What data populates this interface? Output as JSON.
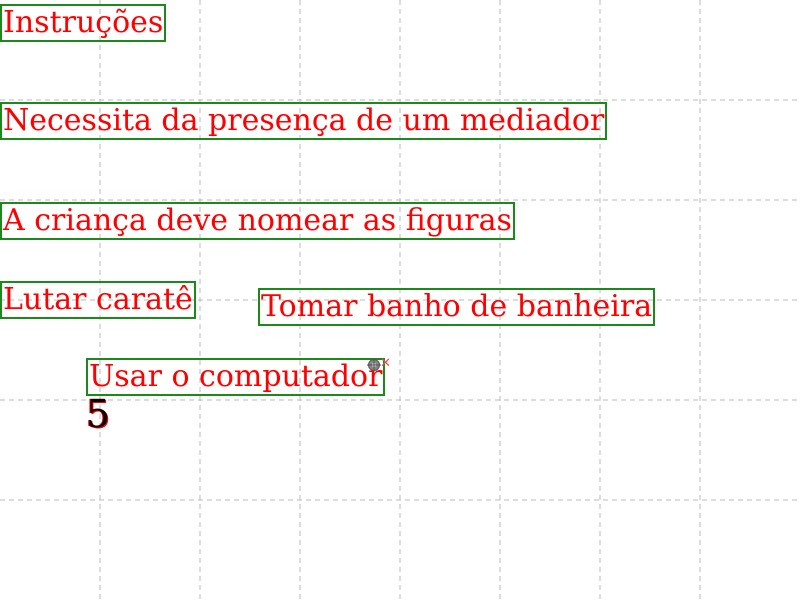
{
  "labels": {
    "instructions": "Instruções",
    "mediator": "Necessita da presença de um mediador",
    "name_figures": "A criança deve nomear as figuras",
    "karate": "Lutar caratê",
    "bathtub": "Tomar banho de banheira",
    "computer": "Usar o computador"
  },
  "number": "5",
  "colors": {
    "text": "#ff0000",
    "border": "#1b8a1b",
    "grid": "#bbbbbb",
    "close": "#e05050"
  },
  "icons": {
    "move_handle": "move-handle-icon",
    "close": "close-icon"
  },
  "close_glyph": "✕"
}
